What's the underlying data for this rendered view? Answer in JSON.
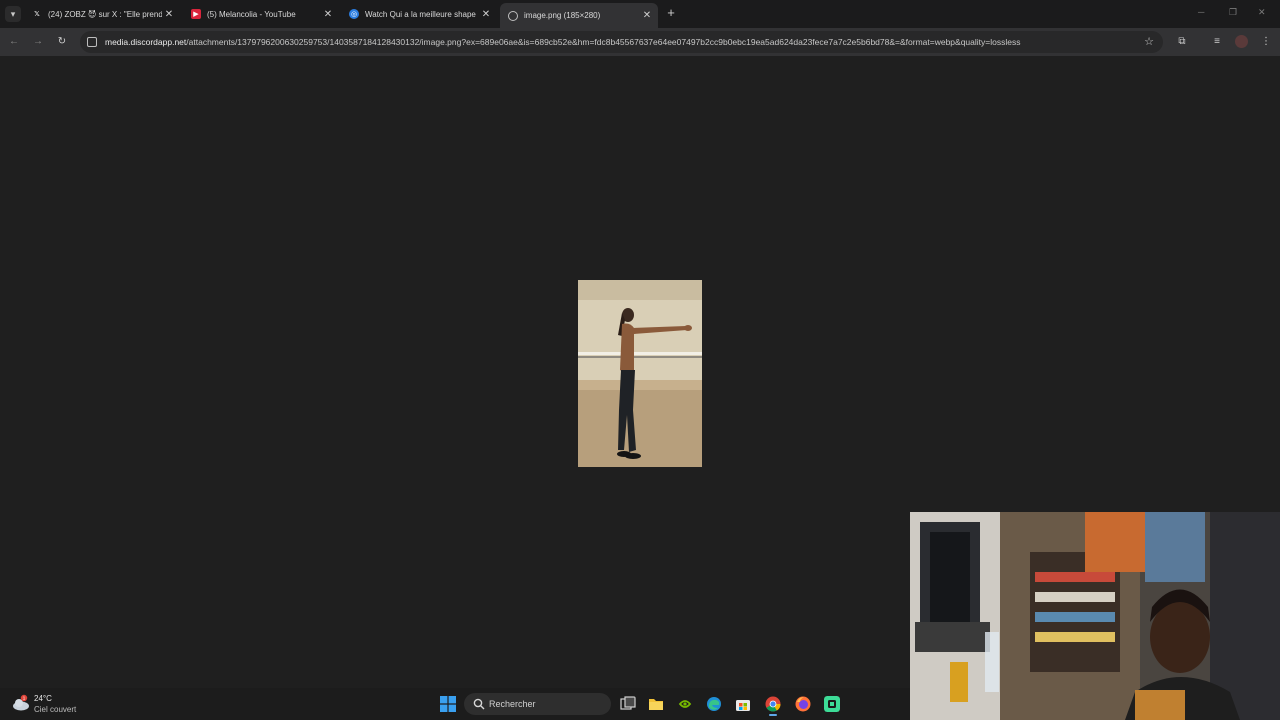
{
  "tabs": [
    {
      "title": "(24) ZOBZ 😈 sur X : \"Elle prend",
      "icon": "x-icon",
      "active": false
    },
    {
      "title": "(5) Melancolia - YouTube",
      "icon": "youtube-icon",
      "active": false
    },
    {
      "title": "Watch Qui a la meilleure shape",
      "icon": "streaming-site-icon",
      "active": false
    },
    {
      "title": "image.png (185×280)",
      "icon": "globe-icon",
      "active": true
    }
  ],
  "address_bar": {
    "host": "media.discordapp.net",
    "path": "/attachments/1379796200630259753/1403587184128430132/image.png?ex=689e06ae&is=689cb52e&hm=fdc8b45567637e64ee07497b2cc9b0ebc19ea5ad624da23fece7a7c2e5b6bd78&=&format=webp&quality=lossless"
  },
  "viewer": {
    "image_alt": "image.png (185×280)"
  },
  "taskbar": {
    "weather": {
      "badge": "1",
      "temp": "24°C",
      "desc": "Ciel couvert"
    },
    "search_label": "Rechercher",
    "apps": [
      "task-view-icon",
      "file-explorer-icon",
      "nvidia-icon",
      "edge-icon",
      "store-icon",
      "chrome-icon",
      "firefox-icon",
      "app-icon"
    ]
  },
  "colors": {
    "page_bg": "#1f1f1f",
    "toolbar": "#323234",
    "tabbar": "#1b1b1c",
    "image_bg": "#c6b89c"
  }
}
